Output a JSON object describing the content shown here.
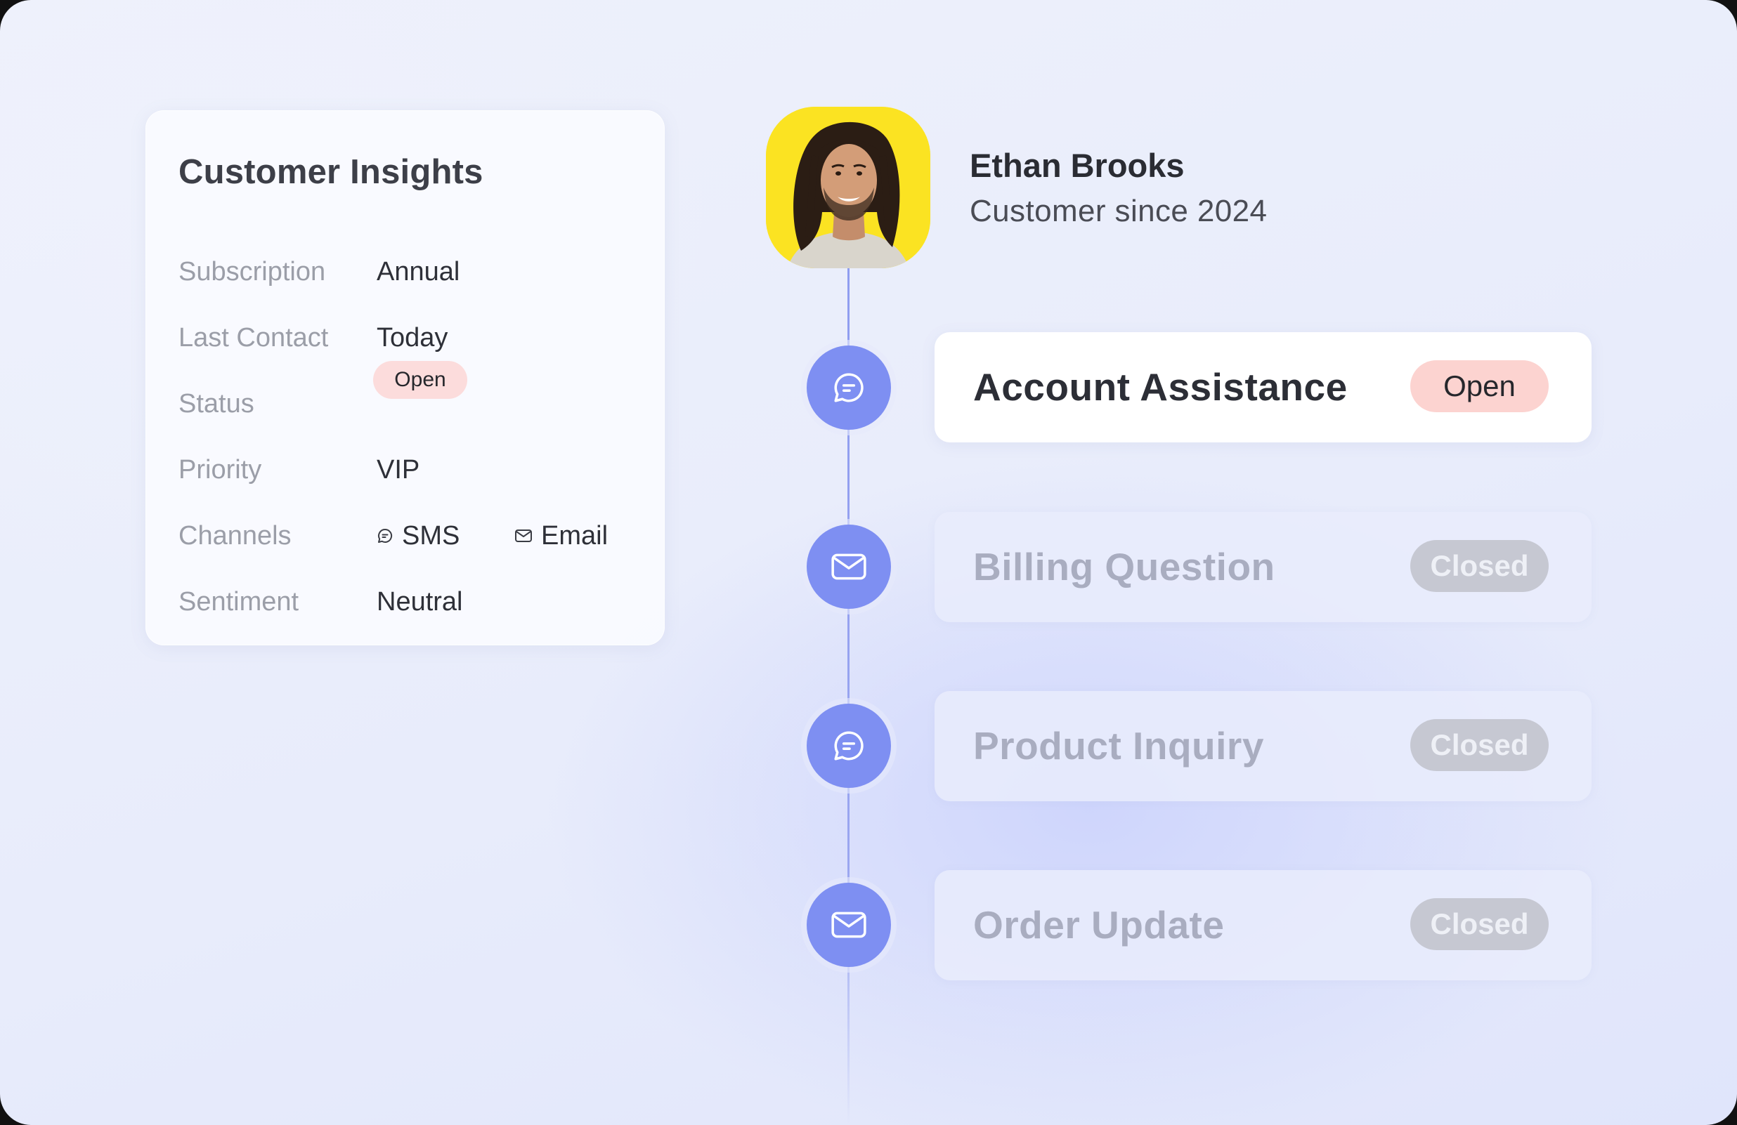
{
  "insights": {
    "title": "Customer Insights",
    "rows": [
      {
        "label": "Subscription",
        "value": "Annual"
      },
      {
        "label": "Last Contact",
        "value": "Today"
      },
      {
        "label": "Status",
        "value": "Open"
      },
      {
        "label": "Priority",
        "value": "VIP"
      },
      {
        "label": "Channels",
        "channels": [
          "SMS",
          "Email"
        ]
      },
      {
        "label": "Sentiment",
        "value": "Neutral"
      }
    ]
  },
  "profile": {
    "name": "Ethan Brooks",
    "subtitle": "Customer since 2024",
    "avatar_bg": "#fbe322"
  },
  "timeline": [
    {
      "title": "Account Assistance",
      "status": "Open",
      "icon": "chat-icon",
      "active": true
    },
    {
      "title": "Billing Question",
      "status": "Closed",
      "icon": "mail-icon",
      "active": false
    },
    {
      "title": "Product Inquiry",
      "status": "Closed",
      "icon": "chat-icon",
      "active": false
    },
    {
      "title": "Order Update",
      "status": "Closed",
      "icon": "mail-icon",
      "active": false
    }
  ],
  "colors": {
    "accent": "#7e8ff2",
    "open_pill": "#fcd3d0",
    "closed_pill": "#c6c8d2"
  }
}
